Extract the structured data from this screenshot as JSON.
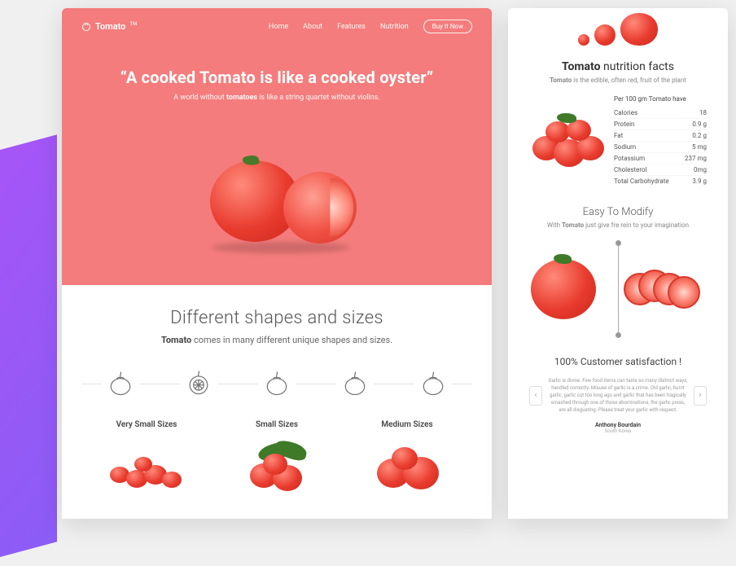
{
  "brand": {
    "name": "Tomato",
    "tm": "TM"
  },
  "nav": {
    "items": [
      "Home",
      "About",
      "Features",
      "Nutrition"
    ],
    "cta": "Buy It Now"
  },
  "hero": {
    "quote": "“A cooked Tomato is like a cooked oyster”",
    "sub_prefix": "A world without ",
    "sub_bold": "tomatoes",
    "sub_suffix": " is like a string quartet without violins."
  },
  "shapes": {
    "title": "Different shapes and sizes",
    "sub_bold": "Tomato",
    "sub_rest": " comes in many different unique shapes and sizes.",
    "sizes": [
      "Very Small Sizes",
      "Small Sizes",
      "Medium Sizes"
    ]
  },
  "nutrition": {
    "title_bold": "Tomato",
    "title_rest": " nutrition facts",
    "sub_bold": "Tomato",
    "sub_rest": " is the edible, often red, fruit of the plant",
    "per_head": "Per 100 gm Tomato have",
    "rows": [
      {
        "label": "Calories",
        "value": "18"
      },
      {
        "label": "Protein",
        "value": "0.9 g"
      },
      {
        "label": "Fat",
        "value": "0.2 g"
      },
      {
        "label": "Sodium",
        "value": "5 mg"
      },
      {
        "label": "Potassium",
        "value": "237 mg"
      },
      {
        "label": "Cholesterol",
        "value": "0mg"
      },
      {
        "label": "Total Carbohydrate",
        "value": "3.9 g"
      }
    ]
  },
  "modify": {
    "title": "Easy To Modify",
    "sub_prefix": "With ",
    "sub_bold": "Tomato",
    "sub_suffix": " just give fre rein to your imagination"
  },
  "customer": {
    "title": "100% Customer satisfaction !",
    "testimonial": "Garlic is divine. Few food items can taste so many distinct ways, handled correctly. Misuse of garlic is a crime. Old garlic, burnt garlic, garlic cut too long ago and garlic that has been tragically smashed through one of those abominations, the garlic press, are all disgusting. Please treat your garlic with respect.",
    "author": "Anthony Bourdain",
    "author_sub": "South Korea"
  }
}
